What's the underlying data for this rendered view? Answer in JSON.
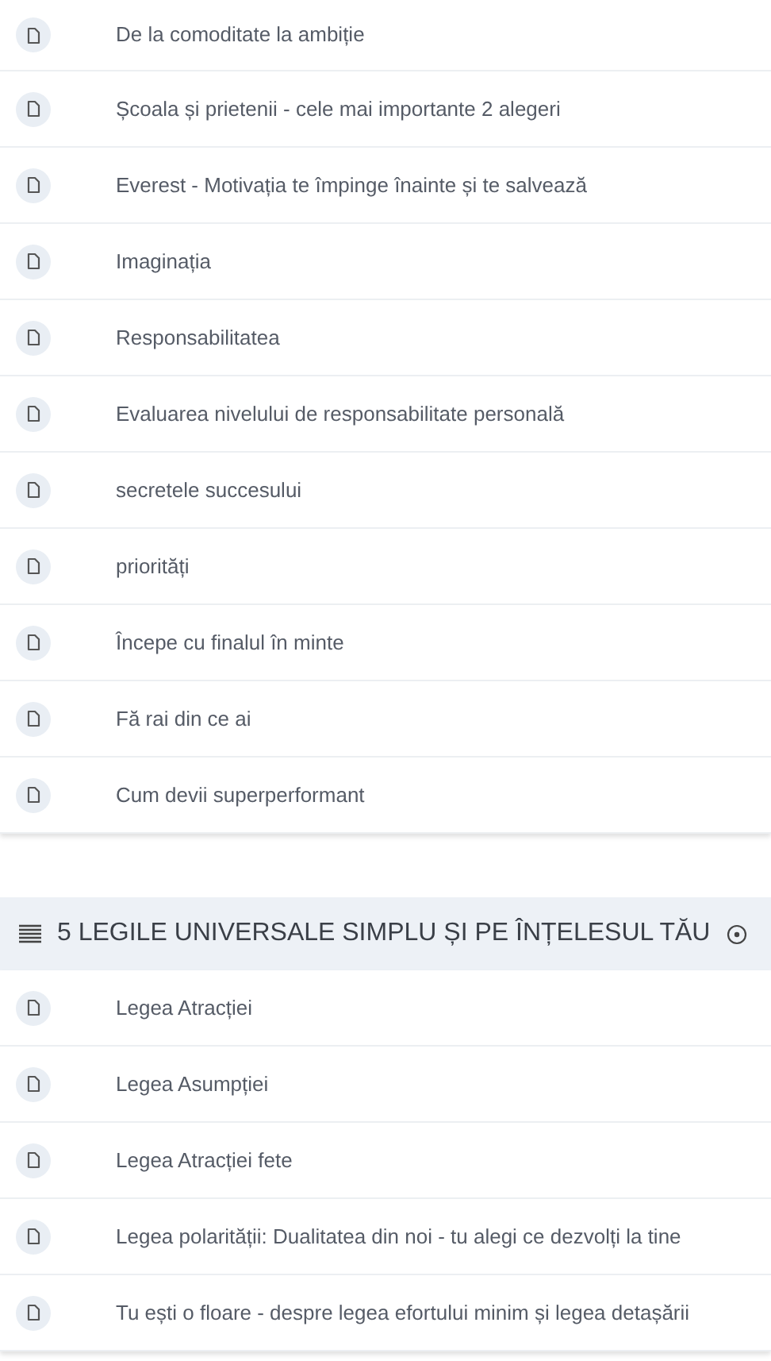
{
  "sections": [
    {
      "lessons": [
        {
          "title": "De la comoditate la ambiție"
        },
        {
          "title": "Școala și prietenii - cele mai importante 2 alegeri"
        },
        {
          "title": "Everest - Motivația te împinge înainte și te salvează"
        },
        {
          "title": "Imaginația"
        },
        {
          "title": "Responsabilitatea"
        },
        {
          "title": "Evaluarea nivelului de responsabilitate personală"
        },
        {
          "title": "secretele succesului"
        },
        {
          "title": "priorități"
        },
        {
          "title": "Începe cu finalul în minte"
        },
        {
          "title": "Fă rai din ce ai"
        },
        {
          "title": "Cum devii superperformant"
        }
      ]
    },
    {
      "title": "5 LEGILE UNIVERSALE SIMPLU ȘI PE ÎNȚELESUL TĂU",
      "lessons": [
        {
          "title": "Legea Atracției"
        },
        {
          "title": "Legea Asumpției"
        },
        {
          "title": "Legea Atracției fete"
        },
        {
          "title": "Legea polarității: Dualitatea din noi - tu alegi ce dezvolți la tine"
        },
        {
          "title": "Tu ești o floare - despre legea efortului minim și legea detașării"
        }
      ]
    }
  ]
}
